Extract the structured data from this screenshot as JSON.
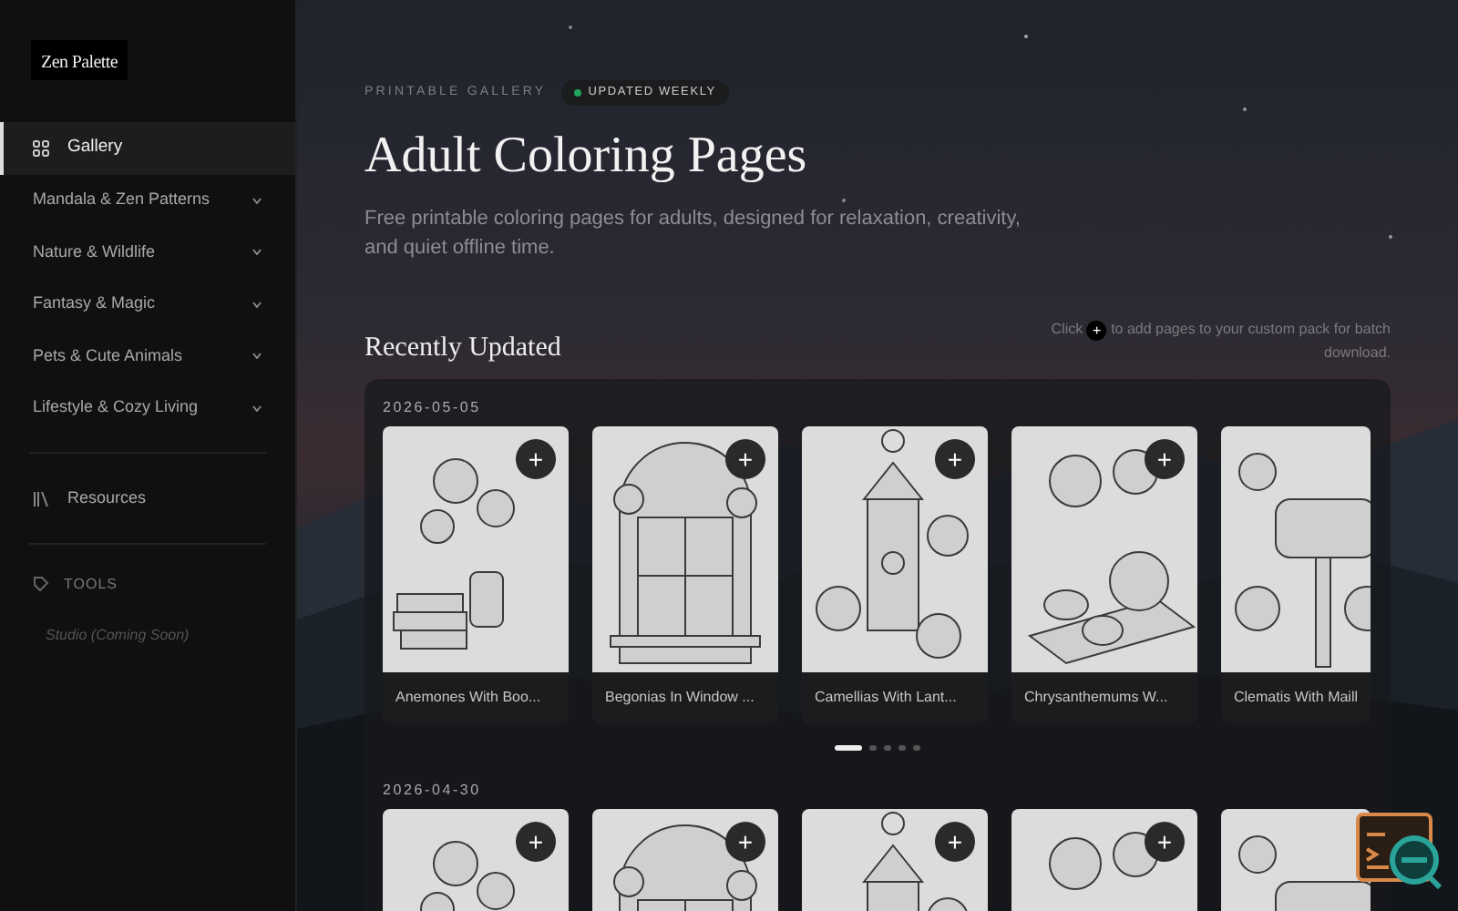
{
  "brand": {
    "name": "Zen Palette"
  },
  "sidebar": {
    "items": [
      {
        "kind": "link",
        "label": "Gallery",
        "selected": true
      },
      {
        "kind": "category",
        "label": "Mandala & Zen Patterns",
        "expanded": false,
        "selected": false
      },
      {
        "kind": "category",
        "label": "Nature & Wildlife",
        "expanded": false,
        "selected": false
      },
      {
        "kind": "category",
        "label": "Fantasy & Magic",
        "expanded": false,
        "selected": false
      },
      {
        "kind": "category",
        "label": "Pets & Cute Animals",
        "expanded": false,
        "selected": false
      },
      {
        "kind": "category",
        "label": "Lifestyle & Cozy Living",
        "expanded": false,
        "selected": false
      },
      {
        "kind": "resources",
        "label": "Resources",
        "selected": false
      }
    ],
    "tools": {
      "heading": "TOOLS",
      "items": [
        {
          "label": "Studio (Coming Soon)",
          "disabled": true
        }
      ]
    }
  },
  "header": {
    "eyebrow": "PRINTABLE GALLERY",
    "badge": "UPDATED WEEKLY",
    "title": "Adult Coloring Pages",
    "description": "Free printable coloring pages for adults, designed for relaxation, creativity, and quiet offline time."
  },
  "recent": {
    "title": "Recently Updated",
    "hint_before": "Click",
    "hint_button": "+",
    "hint_after": "to add pages to your custom pack for batch download.",
    "groups": [
      {
        "date": "2026-05-05",
        "cards": [
          {
            "kind": "picture",
            "caption": "Anemones With Boo...",
            "add": "+"
          },
          {
            "kind": "picture",
            "caption": "Begonias In Window ...",
            "add": "+"
          },
          {
            "kind": "picture",
            "caption": "Camellias With Lant...",
            "add": "+"
          },
          {
            "kind": "picture",
            "caption": "Chrysanthemums W...",
            "add": "+"
          },
          {
            "kind": "picture",
            "caption": "Clematis With Maill"
          }
        ],
        "pager": [
          {
            "selected": true
          },
          {
            "selected": false
          },
          {
            "selected": false
          },
          {
            "selected": false
          },
          {
            "selected": false
          }
        ]
      },
      {
        "date": "2026-04-30",
        "cards": [
          {
            "kind": "picture",
            "add": "+"
          },
          {
            "kind": "picture",
            "add": "+"
          },
          {
            "kind": "picture",
            "add": "+"
          },
          {
            "kind": "picture",
            "add": "+"
          },
          {
            "kind": "picture"
          }
        ]
      }
    ]
  }
}
